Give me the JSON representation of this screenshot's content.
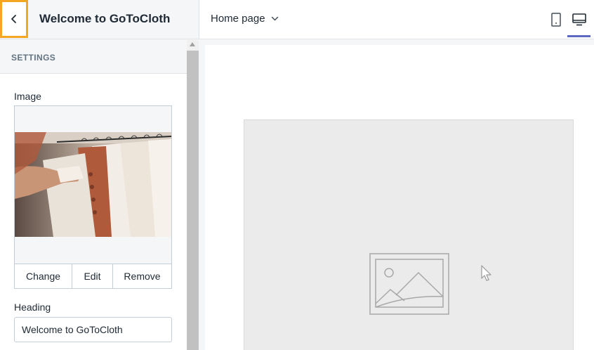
{
  "header": {
    "title": "Welcome to GoToCloth",
    "page_selector": "Home page",
    "back_icon": "chevron-left-icon",
    "view_icons": [
      "mobile-icon",
      "desktop-icon"
    ],
    "accent_color": "#5c6ac4",
    "focus_color": "#f5a623"
  },
  "sidebar": {
    "section_title": "SETTINGS",
    "image_label": "Image",
    "image_actions": {
      "change": "Change",
      "edit": "Edit",
      "remove": "Remove"
    },
    "heading_label": "Heading",
    "heading_value": "Welcome to GoToCloth"
  },
  "preview": {
    "placeholder_icon": "image-placeholder-icon"
  }
}
